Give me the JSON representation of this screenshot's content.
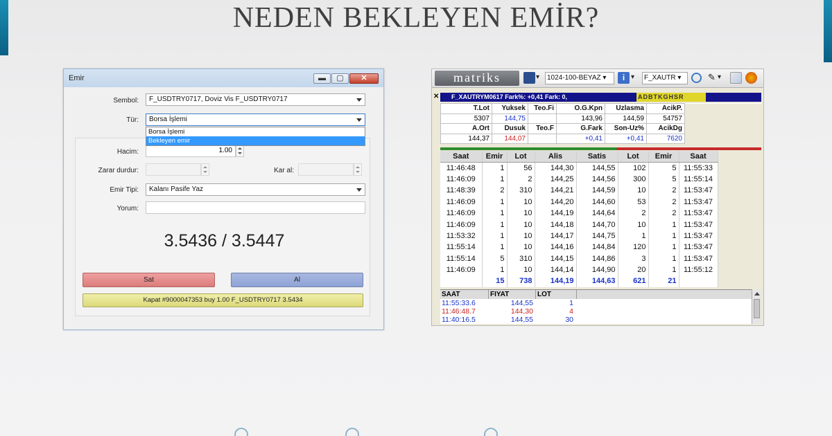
{
  "slide": {
    "title": "NEDEN BEKLEYEN EMİR?"
  },
  "emir_window": {
    "title": "Emir",
    "labels": {
      "sembol": "Sembol:",
      "tur": "Tür:",
      "hacim": "Hacim:",
      "zarar_durdur": "Zarar durdur:",
      "kar_al": "Kar al:",
      "emir_tipi": "Emir Tipi:",
      "yorum": "Yorum:"
    },
    "sembol_value": "F_USDTRY0717, Doviz Vis F_USDTRY0717",
    "tur_value": "Borsa İşlemi",
    "tur_options": [
      "Borsa İşlemi",
      "Bekleyen emir"
    ],
    "tur_highlighted": "Bekleyen emir",
    "hacim_value": "1.00",
    "emir_tipi_value": "Kalanı Pasife Yaz",
    "price": "3.5436 / 3.5447",
    "sat_label": "Sat",
    "al_label": "Al",
    "kapat_label": "Kapat #9000047353 buy 1.00 F_USDTRY0717 3.5434"
  },
  "matriks": {
    "logo": "matriks",
    "layout_combo": "1024-100-BEYAZ",
    "symbol_combo": "F_XAUTR",
    "ticker": "F_XAUTRYM0617  Fark%: +0,41   Fark: 0,",
    "ticker_flags": "ADBTKGHSR",
    "summary": {
      "row1_headers": [
        "T.Lot",
        "Yuksek",
        "Teo.Fi",
        "O.G.Kpn",
        "Uzlasma",
        "AcikP."
      ],
      "row1_values": [
        "5307",
        "144,75",
        "",
        "143,96",
        "144,59",
        "54757"
      ],
      "row2_headers": [
        "A.Ort",
        "Dusuk",
        "Teo.F",
        "G.Fark",
        "Son-Uz%",
        "AcikDg"
      ],
      "row2_values": [
        "144,37",
        "144,07",
        "",
        "+0,41",
        "+0,41",
        "7620"
      ]
    },
    "trades": {
      "headers": [
        "Saat",
        "Emir",
        "Lot",
        "Alis",
        "Satis",
        "Lot",
        "Emir",
        "Saat"
      ],
      "rows": [
        [
          "11:46:48",
          "1",
          "56",
          "144,30",
          "144,55",
          "102",
          "5",
          "11:55:33"
        ],
        [
          "11:46:09",
          "1",
          "2",
          "144,25",
          "144,56",
          "300",
          "5",
          "11:55:14"
        ],
        [
          "11:48:39",
          "2",
          "310",
          "144,21",
          "144,59",
          "10",
          "2",
          "11:53:47"
        ],
        [
          "11:46:09",
          "1",
          "10",
          "144,20",
          "144,60",
          "53",
          "2",
          "11:53:47"
        ],
        [
          "11:46:09",
          "1",
          "10",
          "144,19",
          "144,64",
          "2",
          "2",
          "11:53:47"
        ],
        [
          "11:46:09",
          "1",
          "10",
          "144,18",
          "144,70",
          "10",
          "1",
          "11:53:47"
        ],
        [
          "11:53:32",
          "1",
          "10",
          "144,17",
          "144,75",
          "1",
          "1",
          "11:53:47"
        ],
        [
          "11:55:14",
          "1",
          "10",
          "144,16",
          "144,84",
          "120",
          "1",
          "11:53:47"
        ],
        [
          "11:55:14",
          "5",
          "310",
          "144,15",
          "144,86",
          "3",
          "1",
          "11:53:47"
        ],
        [
          "11:46:09",
          "1",
          "10",
          "144,14",
          "144,90",
          "20",
          "1",
          "11:55:12"
        ]
      ],
      "totals": [
        "",
        "15",
        "738",
        "144,19",
        "144,63",
        "621",
        "21",
        ""
      ]
    },
    "history": {
      "headers": [
        "SAAT",
        "FIYAT",
        "LOT"
      ],
      "rows": [
        {
          "saat": "11:55:33.6",
          "fiyat": "144,55",
          "lot": "1",
          "color": "#1832c8"
        },
        {
          "saat": "11:46:48.7",
          "fiyat": "144,30",
          "lot": "4",
          "color": "#c82020"
        },
        {
          "saat": "11:40:16.5",
          "fiyat": "144,55",
          "lot": "30",
          "color": "#1832c8"
        }
      ]
    }
  },
  "colors": {
    "sat_button": "#dc7c7c",
    "al_button": "#8ea3d6",
    "kapat_button": "#dcd97a",
    "ticker_bg": "#13138a"
  }
}
